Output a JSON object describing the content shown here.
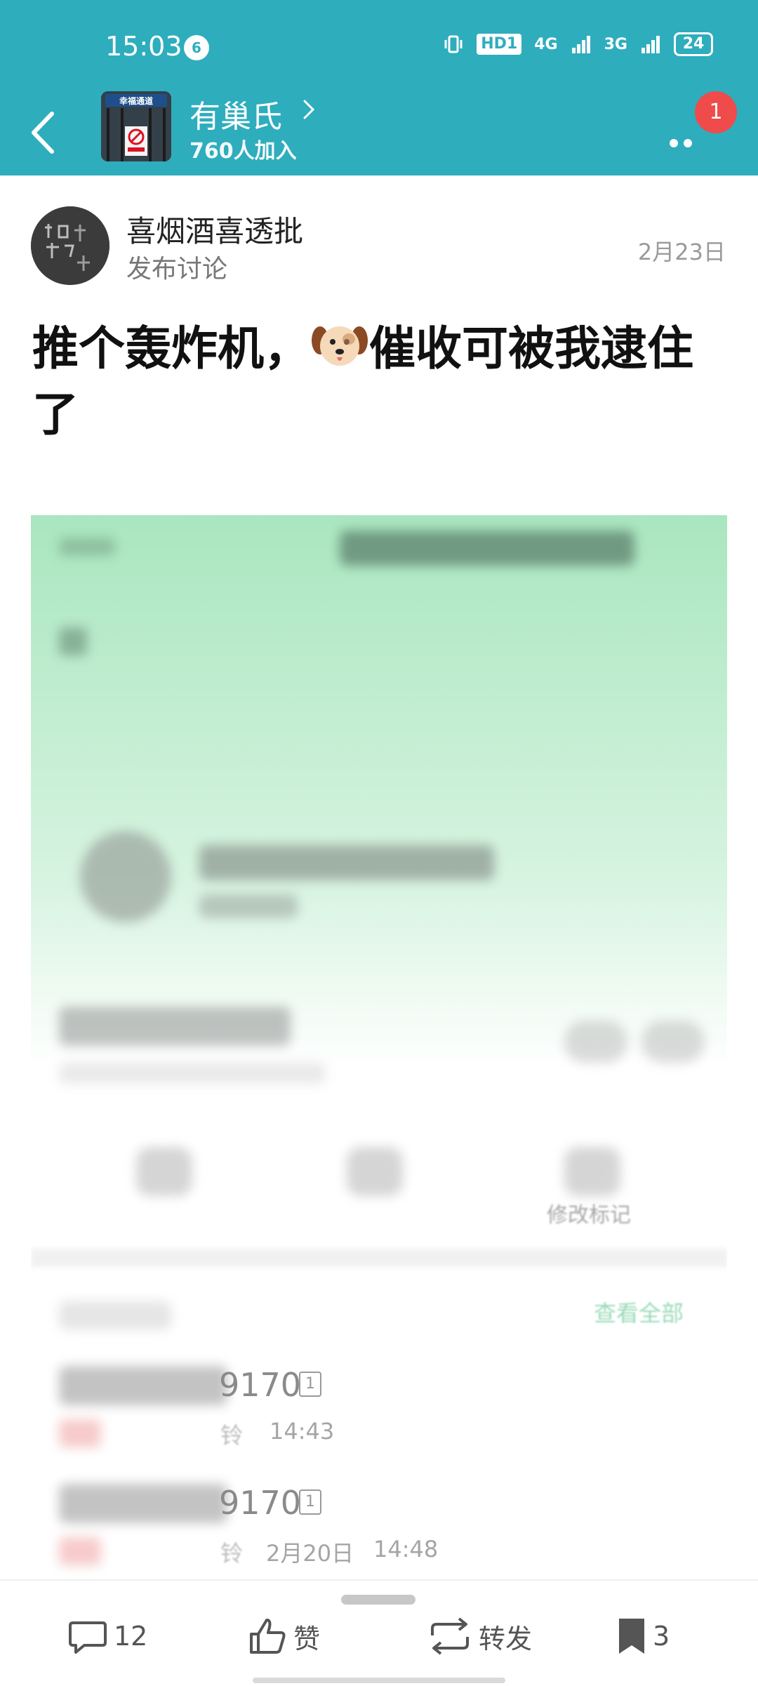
{
  "status_bar": {
    "time": "15:03",
    "notification_count": "6",
    "hd_label": "HD1",
    "net1": "4G",
    "net2": "3G",
    "battery": "24"
  },
  "header": {
    "group_name": "有巢氏",
    "member_count": "760人加入",
    "badge_count": "1",
    "group_avatar_sign": "幸福通道"
  },
  "post": {
    "author": "喜烟酒喜透批",
    "action": "发布讨论",
    "date": "2月23日",
    "title_before": "推个轰炸机，",
    "title_after": "催收可被我逮住了"
  },
  "image": {
    "link_view_all": "查看全部",
    "menu_label": "修改标记",
    "row1_number": "9170",
    "row1_time": "14:43",
    "row2_number": "9170",
    "row2_date": "2月20日",
    "row2_time": "14:48",
    "row_suffix": "铃"
  },
  "bottom_bar": {
    "comment_count": "12",
    "like_label": "赞",
    "share_label": "转发",
    "bookmark_count": "3"
  },
  "colors": {
    "brand": "#2eadbd",
    "badge": "#ef4b4b",
    "accent_green": "#58c28a"
  }
}
